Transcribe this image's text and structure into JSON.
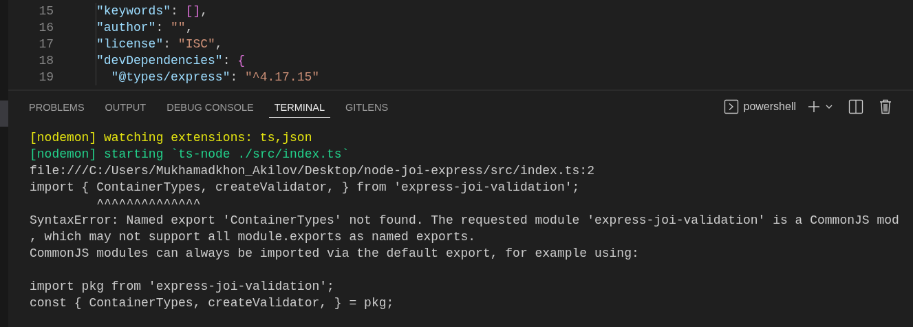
{
  "editor": {
    "lines": [
      {
        "number": "15",
        "tokens": [
          {
            "kind": "key",
            "text": "\"keywords\""
          },
          {
            "kind": "punct",
            "text": ": "
          },
          {
            "kind": "bracket",
            "text": "[]"
          },
          {
            "kind": "punct",
            "text": ","
          }
        ]
      },
      {
        "number": "16",
        "tokens": [
          {
            "kind": "key",
            "text": "\"author\""
          },
          {
            "kind": "punct",
            "text": ": "
          },
          {
            "kind": "string",
            "text": "\"\""
          },
          {
            "kind": "punct",
            "text": ","
          }
        ]
      },
      {
        "number": "17",
        "tokens": [
          {
            "kind": "key",
            "text": "\"license\""
          },
          {
            "kind": "punct",
            "text": ": "
          },
          {
            "kind": "string",
            "text": "\"ISC\""
          },
          {
            "kind": "punct",
            "text": ","
          }
        ]
      },
      {
        "number": "18",
        "tokens": [
          {
            "kind": "key",
            "text": "\"devDependencies\""
          },
          {
            "kind": "punct",
            "text": ": "
          },
          {
            "kind": "bracket",
            "text": "{"
          }
        ]
      },
      {
        "number": "19",
        "tokens": [
          {
            "kind": "key",
            "text": "  \"@types/express\""
          },
          {
            "kind": "punct",
            "text": ": "
          },
          {
            "kind": "string",
            "text": "\"^4.17.15\""
          }
        ]
      }
    ]
  },
  "panel": {
    "tabs": [
      {
        "label": "PROBLEMS",
        "selected": false
      },
      {
        "label": "OUTPUT",
        "selected": false
      },
      {
        "label": "DEBUG CONSOLE",
        "selected": false
      },
      {
        "label": "TERMINAL",
        "selected": true
      },
      {
        "label": "GITLENS",
        "selected": false
      }
    ],
    "shell": "powershell",
    "terminal": [
      {
        "kind": "warn",
        "text": "[nodemon] watching extensions: ts,json"
      },
      {
        "kind": "info",
        "text": "[nodemon] starting `ts-node ./src/index.ts`"
      },
      {
        "kind": "plain",
        "text": "file:///C:/Users/Mukhamadkhon_Akilov/Desktop/node-joi-express/src/index.ts:2"
      },
      {
        "kind": "plain",
        "text": "import { ContainerTypes, createValidator, } from 'express-joi-validation';"
      },
      {
        "kind": "plain",
        "text": "         ^^^^^^^^^^^^^^"
      },
      {
        "kind": "plain",
        "text": "SyntaxError: Named export 'ContainerTypes' not found. The requested module 'express-joi-validation' is a CommonJS mod"
      },
      {
        "kind": "plain",
        "text": ", which may not support all module.exports as named exports."
      },
      {
        "kind": "plain",
        "text": "CommonJS modules can always be imported via the default export, for example using:"
      },
      {
        "kind": "blank"
      },
      {
        "kind": "plain",
        "text": "import pkg from 'express-joi-validation';"
      },
      {
        "kind": "plain",
        "text": "const { ContainerTypes, createValidator, } = pkg;"
      }
    ]
  }
}
